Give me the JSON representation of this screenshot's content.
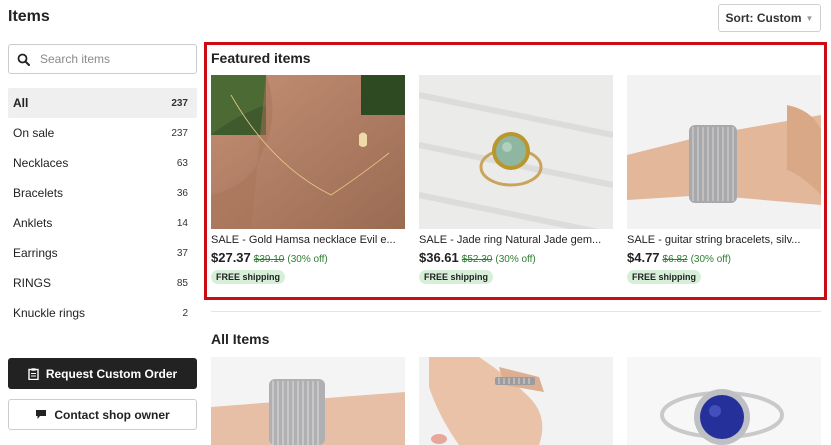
{
  "header": {
    "title": "Items",
    "sort_label": "Sort: Custom"
  },
  "sidebar": {
    "search_placeholder": "Search items",
    "categories": [
      {
        "label": "All",
        "count": "237"
      },
      {
        "label": "On sale",
        "count": "237"
      },
      {
        "label": "Necklaces",
        "count": "63"
      },
      {
        "label": "Bracelets",
        "count": "36"
      },
      {
        "label": "Anklets",
        "count": "14"
      },
      {
        "label": "Earrings",
        "count": "37"
      },
      {
        "label": "RINGS",
        "count": "85"
      },
      {
        "label": "Knuckle rings",
        "count": "2"
      }
    ],
    "request_button": "Request Custom Order",
    "contact_button": "Contact shop owner"
  },
  "featured": {
    "title": "Featured items",
    "items": [
      {
        "title": "SALE - Gold Hamsa necklace Evil e...",
        "price": "$27.37",
        "original": "$39.10",
        "discount": "(30% off)",
        "badge": "FREE shipping",
        "image_icon": "hamsa-necklace-photo"
      },
      {
        "title": "SALE - Jade ring Natural Jade gem...",
        "price": "$36.61",
        "original": "$52.30",
        "discount": "(30% off)",
        "badge": "FREE shipping",
        "image_icon": "jade-ring-photo"
      },
      {
        "title": "SALE - guitar string bracelets, silv...",
        "price": "$4.77",
        "original": "$6.82",
        "discount": "(30% off)",
        "badge": "FREE shipping",
        "image_icon": "string-bracelet-photo"
      }
    ]
  },
  "all_items": {
    "title": "All Items",
    "image_icons": [
      "wire-bracelet-photo",
      "hand-ring-photo",
      "blue-gem-ring-photo"
    ]
  },
  "colors": {
    "highlight_border": "#cc0c13",
    "sale_green": "#2f7d32",
    "badge_bg": "#d7efd9",
    "dark_button": "#222222"
  }
}
